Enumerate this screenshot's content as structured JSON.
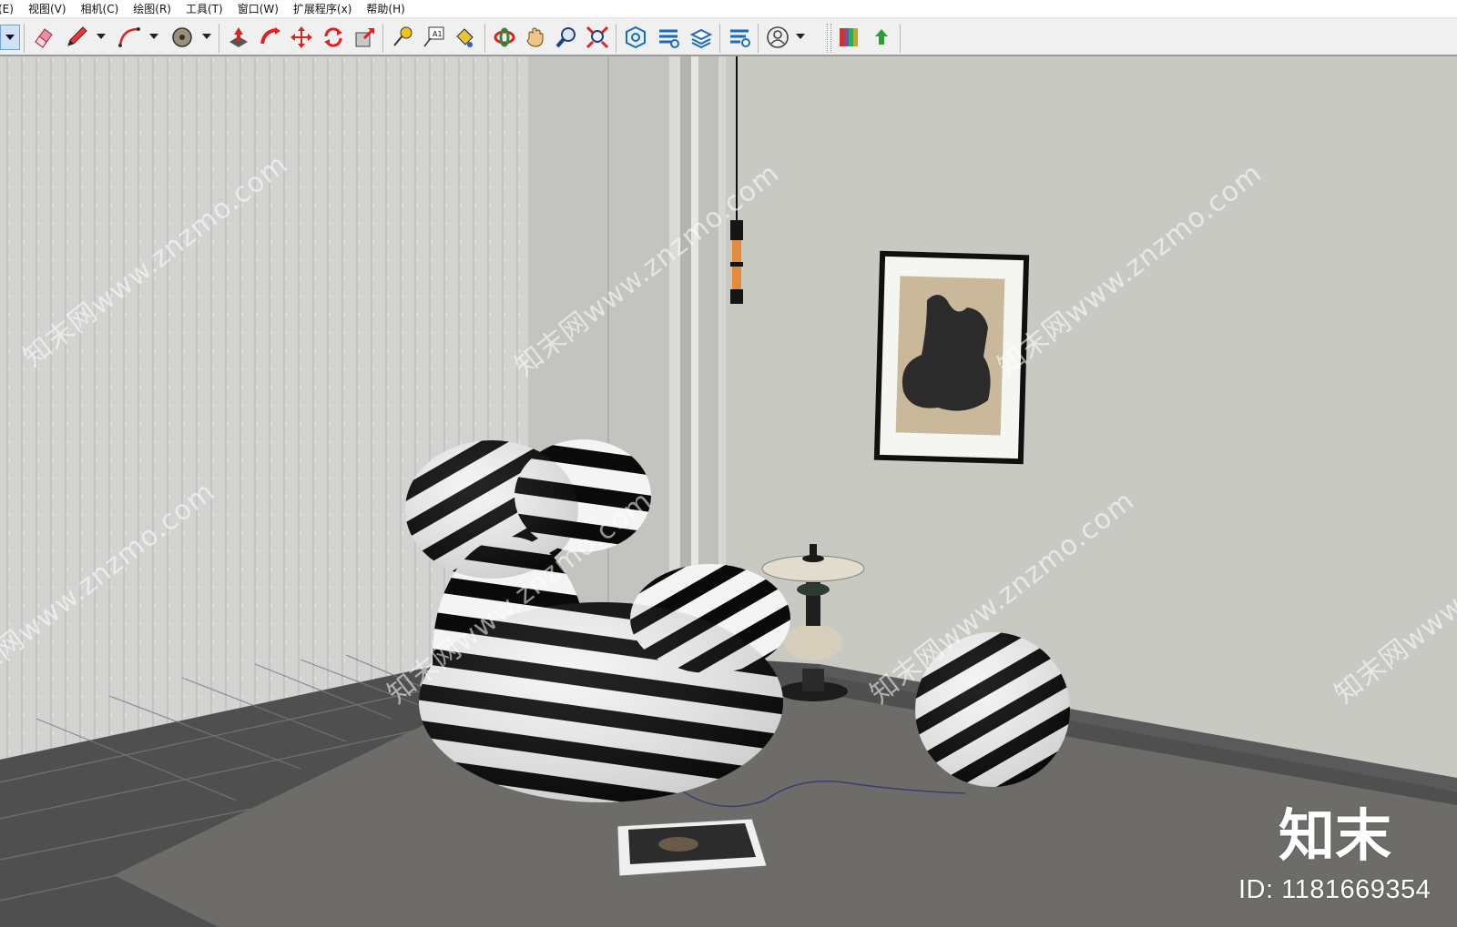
{
  "menu": [
    "(E)",
    "视图(V)",
    "相机(C)",
    "绘图(R)",
    "工具(T)",
    "窗口(W)",
    "扩展程序(x)",
    "帮助(H)"
  ],
  "toolbar": {
    "tools": [
      {
        "name": "select-dropdown-icon"
      },
      {
        "name": "eraser-icon"
      },
      {
        "name": "pencil-line-icon"
      },
      {
        "name": "arc-icon"
      },
      {
        "name": "circle-icon"
      },
      {
        "name": "push-pull-icon"
      },
      {
        "name": "follow-me-icon"
      },
      {
        "name": "move-icon"
      },
      {
        "name": "rotate-icon"
      },
      {
        "name": "scale-icon"
      },
      {
        "name": "tape-measure-icon"
      },
      {
        "name": "text-label-icon"
      },
      {
        "name": "paint-bucket-icon"
      },
      {
        "name": "orbit-icon"
      },
      {
        "name": "pan-hand-icon"
      },
      {
        "name": "zoom-icon"
      },
      {
        "name": "zoom-extents-icon"
      },
      {
        "name": "warehouse-icon"
      },
      {
        "name": "extension-warehouse-icon"
      },
      {
        "name": "layer-manager-icon"
      },
      {
        "name": "extension-settings-icon"
      },
      {
        "name": "account-icon"
      },
      {
        "name": "color-palette-icon"
      },
      {
        "name": "upload-arrow-icon"
      }
    ],
    "text_tool_label": "A1"
  },
  "viewport": {
    "watermarks": [
      "知末网www.znzmo.com",
      "知末网www.znzmo.com",
      "知末网www.znzmo.com",
      "知末网www.znzmo.com",
      "知末网www.znzmo.com",
      "知末网www.znzmo.com",
      "知末网www.znzmo.com"
    ],
    "logo_text": "知末",
    "id_text": "ID: 1181669354"
  },
  "colors": {
    "wall": "#c9c9c4",
    "curtain": "#d4d4d2",
    "floor": "#4f4f4f",
    "rug": "#6e6c69",
    "stripe_dark": "#0a0a0a",
    "stripe_light": "#f4f4f4",
    "lamp_orange": "#e38b3b"
  }
}
